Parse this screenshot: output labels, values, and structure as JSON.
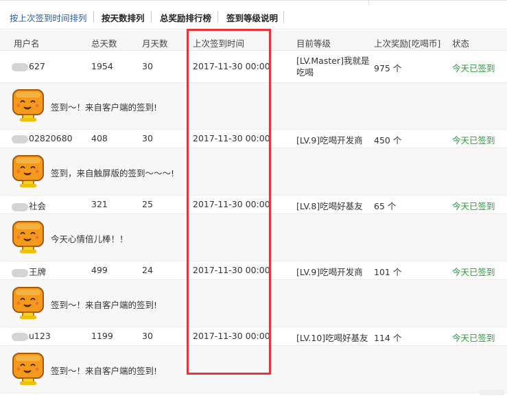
{
  "tabs": [
    {
      "label": "按上次签到时间排列",
      "active": true
    },
    {
      "label": "按天数排列",
      "active": false
    },
    {
      "label": "总奖励排行榜",
      "active": false
    },
    {
      "label": "签到等级说明",
      "active": false
    }
  ],
  "columns": [
    "用户名",
    "总天数",
    "月天数",
    "上次签到时间",
    "目前等级",
    "上次奖励[吃喝币]",
    "状态"
  ],
  "rows": [
    {
      "user": "627",
      "total": "1954",
      "month": "30",
      "time": "2017-11-30 00:00",
      "level": "[LV.Master]我就是吃喝",
      "reward": "975 个",
      "status": "今天已签到",
      "comment": "签到～！来自客户端的签到!"
    },
    {
      "user": "02820680",
      "total": "408",
      "month": "30",
      "time": "2017-11-30 00:00",
      "level": "[LV.9]吃喝开发商",
      "reward": "450 个",
      "status": "今天已签到",
      "comment": "签到，来自触屏版的签到～～～!"
    },
    {
      "user": "社会",
      "total": "321",
      "month": "25",
      "time": "2017-11-30 00:00",
      "level": "[LV.8]吃喝好基友",
      "reward": "65 个",
      "status": "今天已签到",
      "comment": "今天心情倍儿棒！！"
    },
    {
      "user": "王牌",
      "total": "499",
      "month": "24",
      "time": "2017-11-30 00:00",
      "level": "[LV.9]吃喝开发商",
      "reward": "101 个",
      "status": "今天已签到",
      "comment": "签到～！来自客户端的签到!"
    },
    {
      "user": "u123",
      "total": "1199",
      "month": "30",
      "time": "2017-11-30 00:00",
      "level": "[LV.10]吃喝好基友",
      "reward": "114 个",
      "status": "今天已签到",
      "comment": "签到～！来自客户端的签到!"
    }
  ],
  "colors": {
    "accent": "#2b5c9e",
    "status": "#2a9a3c",
    "highlight": "#e8333a"
  },
  "icons": {
    "mood": "happy-bread-emoji-icon"
  }
}
